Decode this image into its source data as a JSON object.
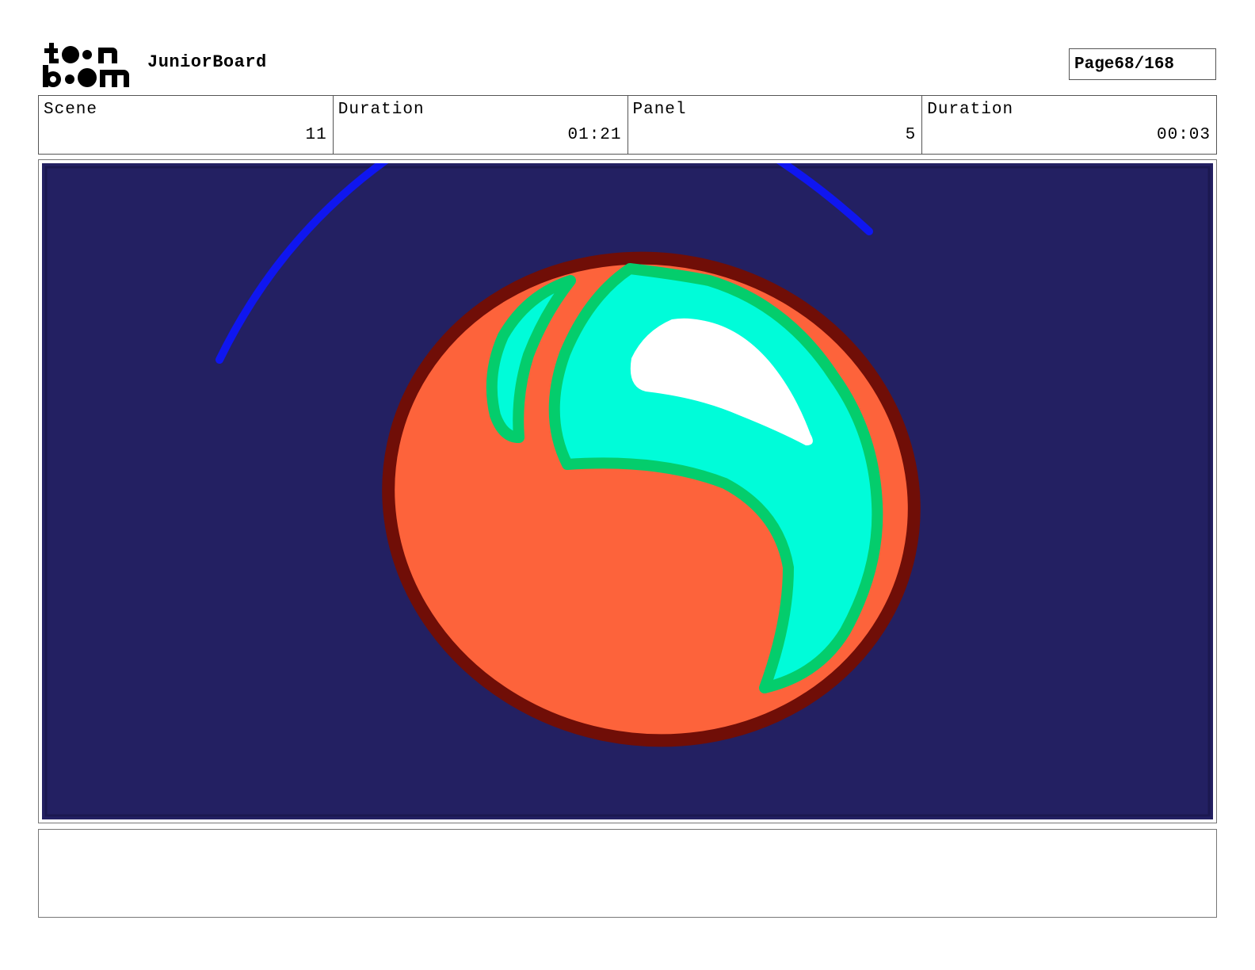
{
  "header": {
    "logo_text": "toon boom",
    "project_title": "JuniorBoard",
    "page_label": "Page",
    "page_value": "68/168"
  },
  "info": {
    "scene_label": "Scene",
    "scene_value": "11",
    "scene_duration_label": "Duration",
    "scene_duration_value": "01:21",
    "panel_label": "Panel",
    "panel_value": "5",
    "panel_duration_label": "Duration",
    "panel_duration_value": "00:03"
  },
  "colors": {
    "background": "#232062",
    "arc": "#0f16f0",
    "ball_outline": "#700e07",
    "ball_fill": "#fd633b",
    "shine_fill": "#00fcd9",
    "shine_outline": "#04cd6c",
    "highlight": "#ffffff"
  },
  "notes": {
    "text": ""
  }
}
